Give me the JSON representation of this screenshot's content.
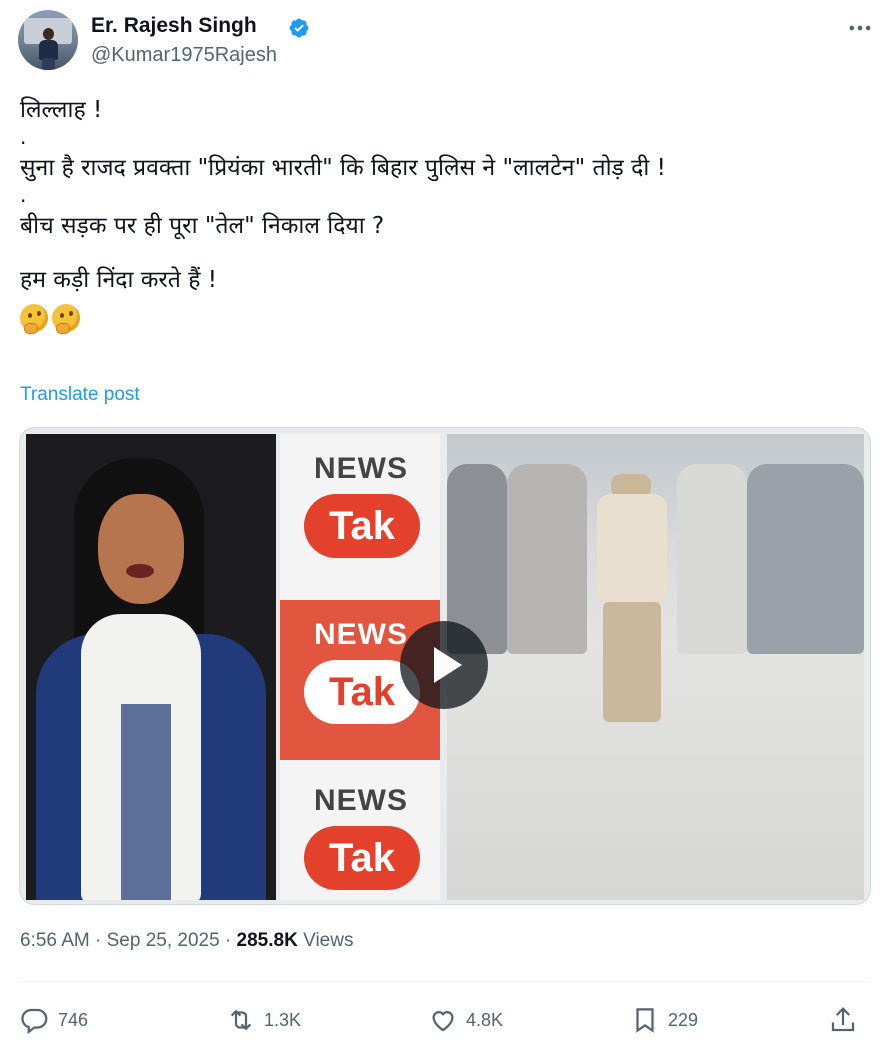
{
  "author": {
    "display_name": "Er. Rajesh Singh",
    "handle": "@Kumar1975Rajesh",
    "verified": true
  },
  "post": {
    "lines": [
      "लिल्लाह !",
      ".",
      "सुना है राजद प्रवक्ता \"प्रियंका भारती\" कि बिहार पुलिस ने \"लालटेन\" तोड़ दी !",
      ".",
      "बीच सड़क पर ही पूरा \"तेल\" निकाल दिया ?",
      "हम कड़ी निंदा करते हैं !"
    ],
    "emojis": [
      "thinking-face",
      "thinking-face"
    ],
    "translate_label": "Translate post"
  },
  "media": {
    "brand_news": "NEWS",
    "brand_tak": "Tak"
  },
  "meta": {
    "time": "6:56 AM",
    "separator": "·",
    "date": "Sep 25, 2025",
    "views_count": "285.8K",
    "views_label": "Views"
  },
  "actions": {
    "replies": "746",
    "reposts": "1.3K",
    "likes": "4.8K",
    "bookmarks": "229"
  },
  "colors": {
    "accent": "#1d9bf0",
    "muted": "#536471",
    "text": "#0f1419"
  }
}
